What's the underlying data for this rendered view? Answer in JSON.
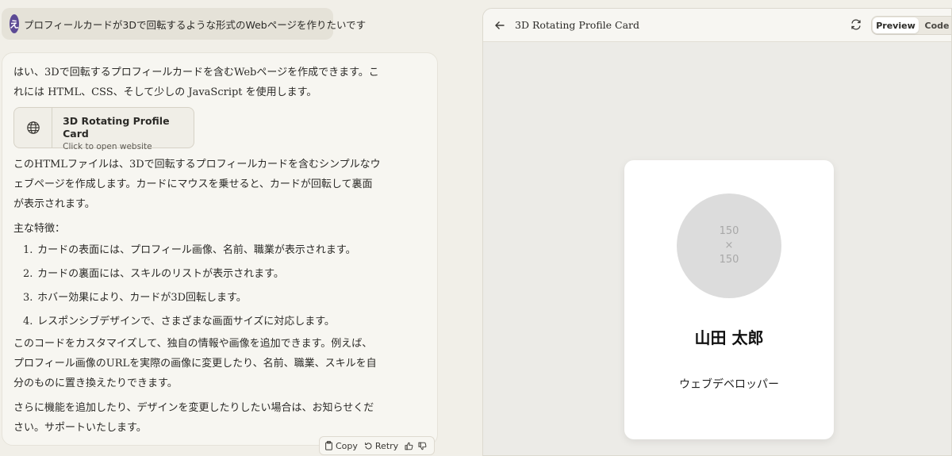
{
  "user_message": {
    "avatar_letter": "え",
    "text": "プロフィールカードが3Dで回転するような形式のWebページを作りたいです"
  },
  "assistant": {
    "intro": [
      "はい、3Dで回転するプロフィールカードを含むWebページを作成できます。こ",
      "れには HTML、CSS、そして少しの JavaScript を使用します。"
    ],
    "artifact": {
      "icon": "globe-icon",
      "title": "3D Rotating Profile Card",
      "subtitle": "Click to open website"
    },
    "description": [
      "このHTMLファイルは、3Dで回転するプロフィールカードを含むシンプルなウ",
      "ェブページを作成します。カードにマウスを乗せると、カードが回転して裏面",
      "が表示されます。"
    ],
    "features_heading": "主な特徴：",
    "features": [
      {
        "num": "1.",
        "text": "カードの表面には、プロフィール画像、名前、職業が表示されます。"
      },
      {
        "num": "2.",
        "text": "カードの裏面には、スキルのリストが表示されます。"
      },
      {
        "num": "3.",
        "text": "ホバー効果により、カードが3D回転します。"
      },
      {
        "num": "4.",
        "text": "レスポンシブデザインで、さまざまな画面サイズに対応します。"
      }
    ],
    "customize": [
      "このコードをカスタマイズして、独自の情報や画像を追加できます。例えば、",
      "プロフィール画像のURLを実際の画像に変更したり、名前、職業、スキルを自",
      "分のものに置き換えたりできます。"
    ],
    "closing": [
      "さらに機能を追加したり、デザインを変更したりしたい場合は、お知らせくだ",
      "さい。サポートいたします。"
    ],
    "actions": {
      "copy": "Copy",
      "retry": "Retry"
    }
  },
  "preview_panel": {
    "title": "3D Rotating Profile Card",
    "tabs": {
      "preview": "Preview",
      "code": "Code"
    },
    "card": {
      "photo_placeholder": [
        "150",
        "×",
        "150"
      ],
      "name": "山田 太郎",
      "role": "ウェブデベロッパー"
    }
  },
  "colors": {
    "background": "#f1efe8",
    "avatar": "#5c4a95",
    "card": "#ffffff"
  }
}
